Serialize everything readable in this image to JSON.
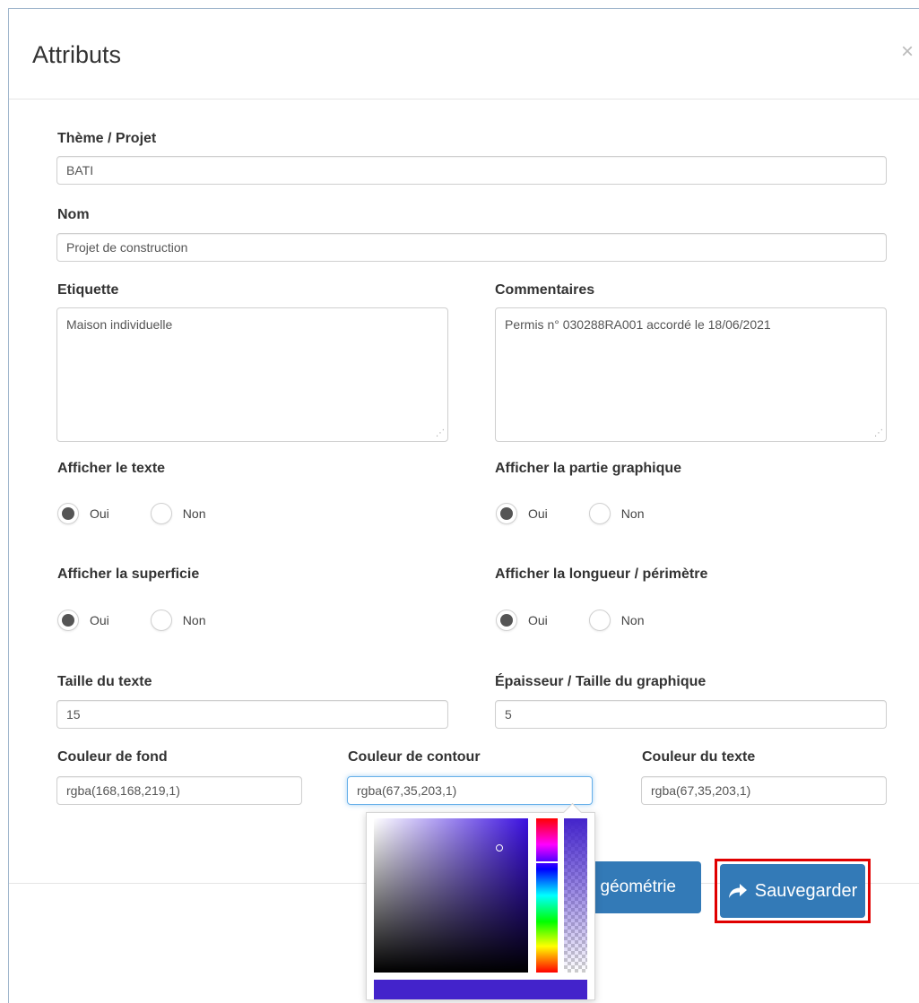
{
  "modal": {
    "title": "Attributs",
    "close_label": "×"
  },
  "fields": {
    "theme": {
      "label": "Thème / Projet",
      "value": "BATI"
    },
    "nom": {
      "label": "Nom",
      "value": "Projet de construction"
    },
    "etiquette": {
      "label": "Etiquette",
      "value": "Maison individuelle"
    },
    "commentaires": {
      "label": "Commentaires",
      "value": "Permis n° 030288RA001 accordé le 18/06/2021"
    },
    "afficher_texte": {
      "label": "Afficher le texte",
      "oui": "Oui",
      "non": "Non",
      "selected": "Oui"
    },
    "afficher_graphique": {
      "label": "Afficher la partie graphique",
      "oui": "Oui",
      "non": "Non",
      "selected": "Oui"
    },
    "afficher_superficie": {
      "label": "Afficher la superficie",
      "oui": "Oui",
      "non": "Non",
      "selected": "Oui"
    },
    "afficher_longueur": {
      "label": "Afficher la longueur / périmètre",
      "oui": "Oui",
      "non": "Non",
      "selected": "Oui"
    },
    "taille_texte": {
      "label": "Taille du texte",
      "value": "15"
    },
    "epaisseur": {
      "label": "Épaisseur / Taille du graphique",
      "value": "5"
    },
    "couleur_fond": {
      "label": "Couleur de fond",
      "value": "rgba(168,168,219,1)"
    },
    "couleur_contour": {
      "label": "Couleur de contour",
      "value": "rgba(67,35,203,1)"
    },
    "couleur_texte": {
      "label": "Couleur du texte",
      "value": "rgba(67,35,203,1)"
    }
  },
  "buttons": {
    "geometrie_label": "géométrie",
    "save_label": "Sauvegarder"
  },
  "colors": {
    "primary": "#337ab7",
    "highlight": "#e00000",
    "picker_preview": "#4323cb"
  }
}
